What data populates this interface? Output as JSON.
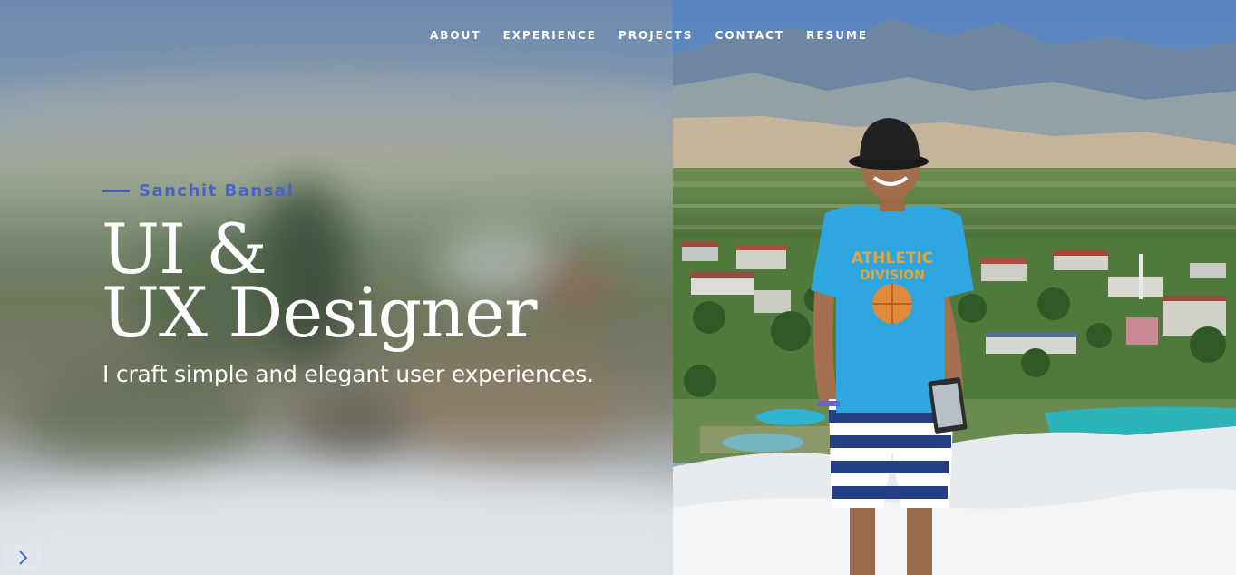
{
  "nav": {
    "items": [
      {
        "label": "ABOUT"
      },
      {
        "label": "EXPERIENCE"
      },
      {
        "label": "PROJECTS"
      },
      {
        "label": "CONTACT"
      },
      {
        "label": "RESUME"
      }
    ]
  },
  "hero": {
    "name": "Sanchit Bansal",
    "headline_line1": "UI &",
    "headline_line2": "UX Designer",
    "tagline": "I craft simple and elegant user experiences."
  },
  "shirt_print": {
    "line1": "ATHLETIC",
    "line2": "DIVISION"
  },
  "icons": {
    "scroll": "chevron-right-icon"
  },
  "colors": {
    "accent": "#4664c6",
    "text": "#ffffff",
    "shirt": "#2ea6e0",
    "pool": "#2ab3b8"
  }
}
